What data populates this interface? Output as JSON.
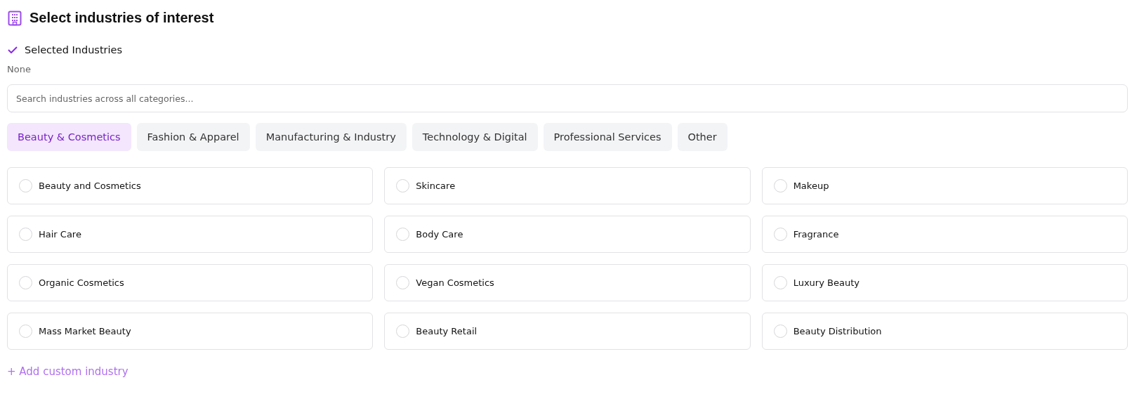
{
  "title": "Select industries of interest",
  "selected_section": {
    "label": "Selected Industries",
    "value": "None"
  },
  "search": {
    "placeholder": "Search industries across all categories..."
  },
  "tabs": [
    {
      "label": "Beauty & Cosmetics",
      "selected": true
    },
    {
      "label": "Fashion & Apparel",
      "selected": false
    },
    {
      "label": "Manufacturing & Industry",
      "selected": false
    },
    {
      "label": "Technology & Digital",
      "selected": false
    },
    {
      "label": "Professional Services",
      "selected": false
    },
    {
      "label": "Other",
      "selected": false
    }
  ],
  "options": [
    {
      "label": "Beauty and Cosmetics",
      "selected": false
    },
    {
      "label": "Skincare",
      "selected": false
    },
    {
      "label": "Makeup",
      "selected": false
    },
    {
      "label": "Hair Care",
      "selected": false
    },
    {
      "label": "Body Care",
      "selected": false
    },
    {
      "label": "Fragrance",
      "selected": false
    },
    {
      "label": "Organic Cosmetics",
      "selected": false
    },
    {
      "label": "Vegan Cosmetics",
      "selected": false
    },
    {
      "label": "Luxury Beauty",
      "selected": false
    },
    {
      "label": "Mass Market Beauty",
      "selected": false
    },
    {
      "label": "Beauty Retail",
      "selected": false
    },
    {
      "label": "Beauty Distribution",
      "selected": false
    }
  ],
  "add_link": "+ Add custom industry"
}
